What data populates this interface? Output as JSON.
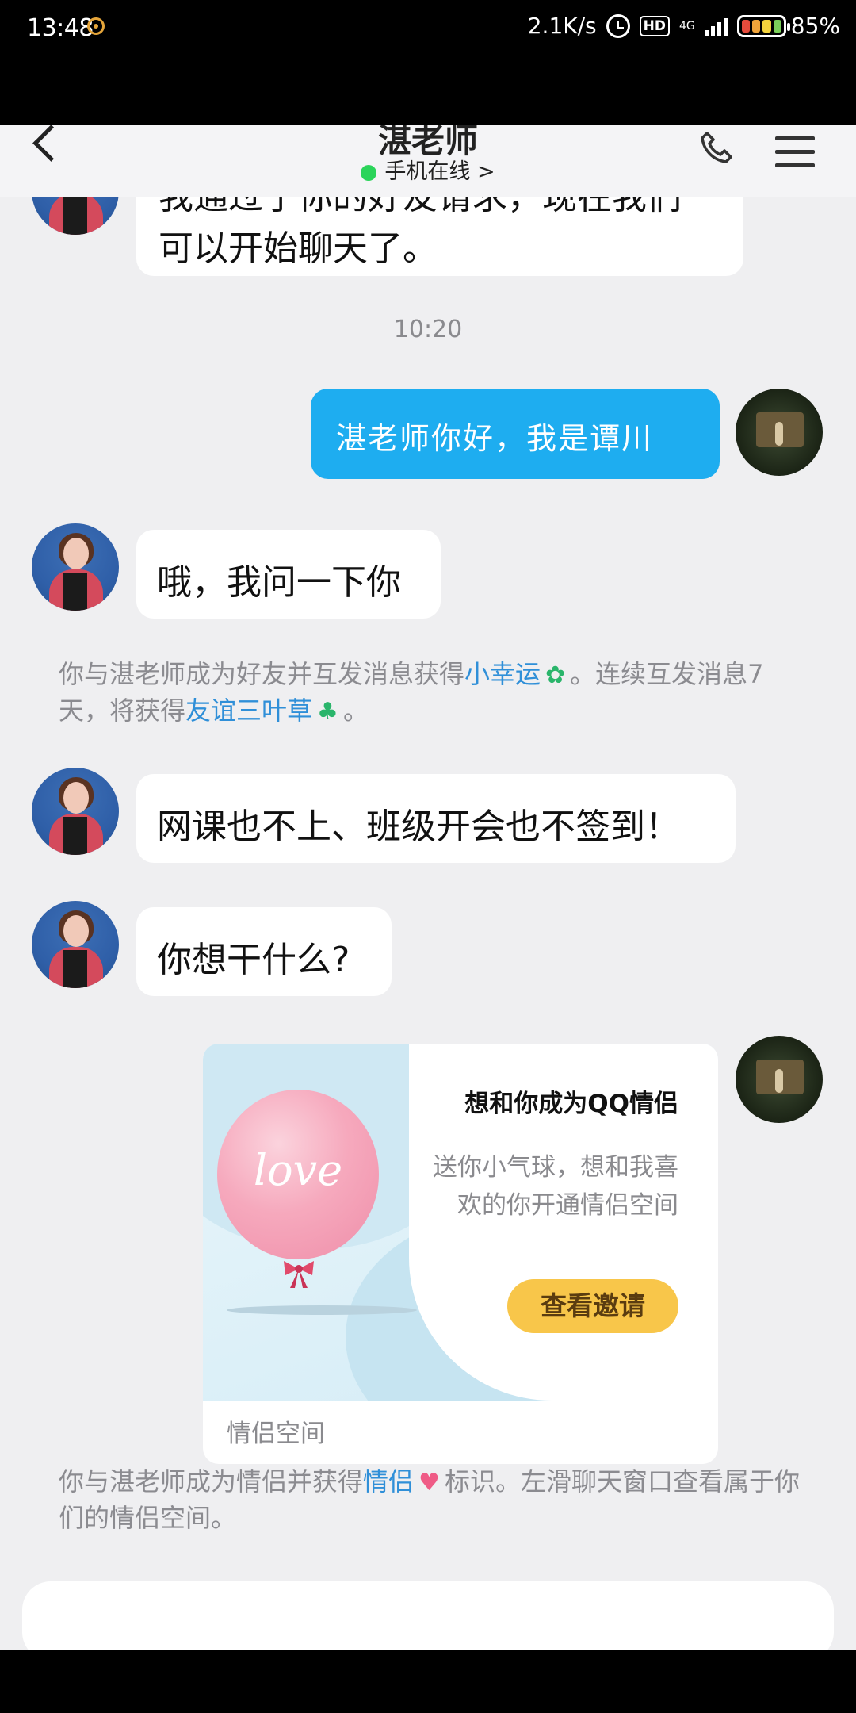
{
  "status_bar": {
    "time": "13:48",
    "net_speed": "2.1K/s",
    "hd": "HD",
    "network": "4G",
    "battery": "85%"
  },
  "nav": {
    "title": "湛老师",
    "subtitle": "手机在线",
    "chevron": ">"
  },
  "messages": {
    "m0": "可以开始聊天了。",
    "m0_partial": "我通过了你的好友请求，现在我们",
    "time": "10:20",
    "m1": "湛老师你好，我是谭川",
    "m2": "哦，我问一下你",
    "m3": "网课也不上、班级开会也不签到！",
    "m4": "你想干什么?"
  },
  "notice1": {
    "part1": "你与湛老师成为好友并互发消息获得",
    "link1": "小幸运",
    "part2": "。连续互发消息7天，将获得",
    "link2": "友谊三叶草",
    "part3": "。"
  },
  "card": {
    "balloon_text": "love",
    "title": "想和你成为QQ情侣",
    "desc": "送你小气球，想和我喜欢的你开通情侣空间",
    "button": "查看邀请",
    "footer": "情侣空间"
  },
  "notice2": {
    "part1": "你与湛老师成为情侣并获得",
    "link": "情侣",
    "part2": "标识。左滑聊天窗口查看属于你们的情侣空间。"
  },
  "colors": {
    "sent_bubble": "#1eadf0",
    "link": "#2f8fd8",
    "online": "#2bd45a",
    "button": "#f8c64a"
  }
}
